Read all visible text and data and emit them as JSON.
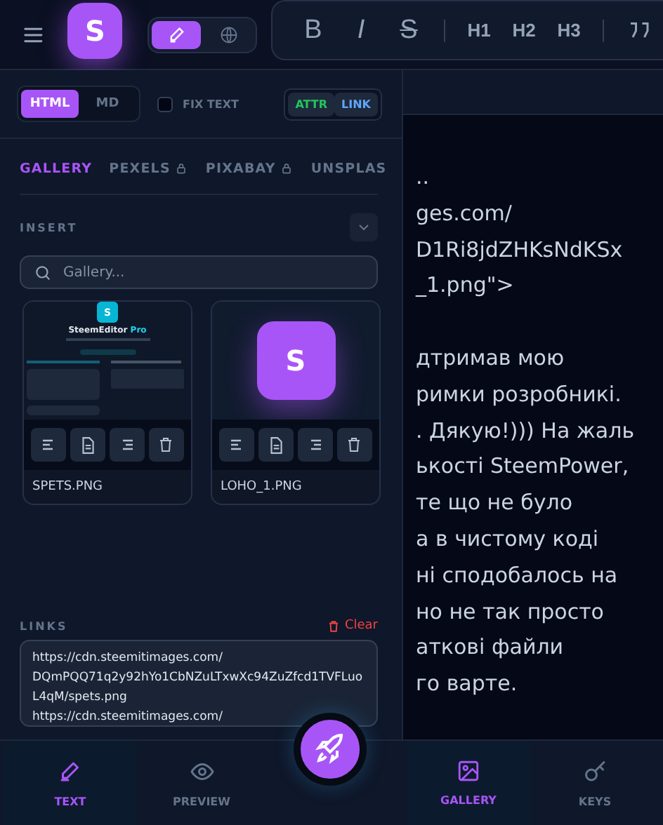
{
  "top_bar": {
    "logo": "S",
    "mode_toggle": [
      {
        "kind": "edit",
        "selected": true
      },
      {
        "kind": "web",
        "selected": false
      }
    ],
    "toolbar": [
      {
        "kind": "bold",
        "label": "B"
      },
      {
        "kind": "italic",
        "label": "I"
      },
      {
        "kind": "strike",
        "label": "S"
      },
      {
        "kind": "divider"
      },
      {
        "kind": "heading",
        "label": "H1"
      },
      {
        "kind": "heading",
        "label": "H2"
      },
      {
        "kind": "heading",
        "label": "H3"
      },
      {
        "kind": "divider"
      },
      {
        "kind": "quote"
      }
    ]
  },
  "panel": {
    "format_toggle": [
      {
        "label": "HTML",
        "selected": true
      },
      {
        "label": "MD",
        "selected": false
      }
    ],
    "fix_text": {
      "label": "FIX TEXT",
      "checked": false
    },
    "link_mode": [
      {
        "label": "ATTR",
        "color": "#22c55e"
      },
      {
        "label": "LINK",
        "color": "#60a5fa"
      }
    ],
    "source_tabs": [
      {
        "label": "GALLERY",
        "selected": true,
        "locked": false
      },
      {
        "label": "PEXELS",
        "selected": false,
        "locked": true
      },
      {
        "label": "PIXABAY",
        "selected": false,
        "locked": true
      },
      {
        "label": "UNSPLAS",
        "selected": false,
        "locked": false
      }
    ],
    "insert_label": "INSERT",
    "search": {
      "placeholder": "Gallery..."
    },
    "gallery": [
      {
        "kind": "screenshot",
        "name": "SPETS.PNG",
        "thumb_logo": "S",
        "thumb_title": "SteemEditor",
        "thumb_badge": "Pro"
      },
      {
        "kind": "logo",
        "name": "LOHO_1.PNG",
        "thumb_logo": "S"
      }
    ],
    "links_label": "LINKS",
    "clear": "Clear",
    "links": "https://cdn.steemitimages.com/\nDQmPQQ71q2y92hYo1CbNZuLTxwXc94ZuZfcd1TVFLuoL4qM/spets.png\nhttps://cdn.steemitimages.com/"
  },
  "editor": {
    "paragraphs": [
      [
        "..",
        "ges.com/",
        "D1Ri8jdZHKsNdKSx",
        "_1.png\">"
      ],
      [
        "дтримав мою",
        "римки розробникі.",
        ". Дякую!))) На жаль",
        "ькості SteemPower,",
        "те що не було",
        "а в чистому коді",
        "ні сподобалось на",
        "но не так просто",
        "аткові файли",
        "го варте."
      ]
    ]
  },
  "bottom_nav": [
    {
      "kind": "text",
      "label": "TEXT",
      "selected": true
    },
    {
      "kind": "preview",
      "label": "PREVIEW",
      "selected": false
    },
    {
      "kind": "publish"
    },
    {
      "kind": "gallery",
      "label": "GALLERY",
      "selected": true
    },
    {
      "kind": "keys",
      "label": "KEYS",
      "selected": false
    }
  ]
}
